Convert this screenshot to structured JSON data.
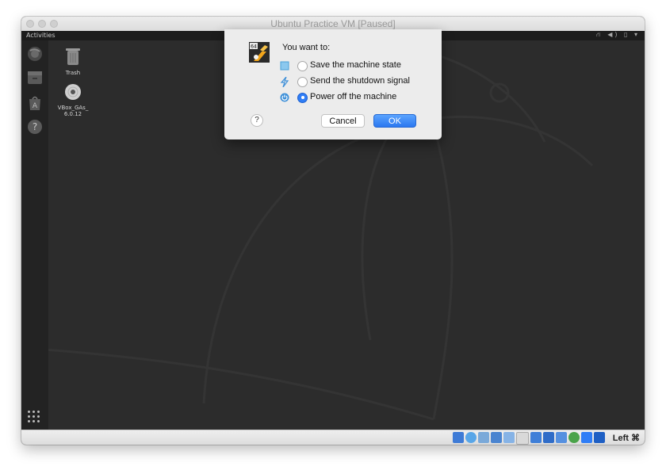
{
  "window": {
    "title": "Ubuntu Practice VM [Paused]"
  },
  "guest": {
    "topbar": {
      "activities": "Activities",
      "tray": "⛙ ◀) ▯ ▾"
    },
    "desktop_icons": [
      {
        "label": "Trash",
        "icon": "trash-icon"
      },
      {
        "label": "VBox_GAs_\n6.0.12",
        "icon": "disc-icon"
      }
    ],
    "dock": [
      "firefox-icon",
      "files-icon",
      "software-icon",
      "help-icon"
    ]
  },
  "dialog": {
    "logo_badge": "64",
    "prompt": "You want to:",
    "options": [
      {
        "label": "Save the machine state",
        "icon": "save-state-icon",
        "checked": false
      },
      {
        "label": "Send the shutdown signal",
        "icon": "shutdown-signal-icon",
        "checked": false
      },
      {
        "label": "Power off the machine",
        "icon": "power-icon",
        "checked": true
      }
    ],
    "help_label": "?",
    "cancel_label": "Cancel",
    "ok_label": "OK"
  },
  "statusbar": {
    "host_key": "Left ⌘",
    "icons": [
      "storage-icon",
      "optical-icon",
      "audio-icon",
      "network-icon",
      "usb-icon",
      "shared-folders-icon",
      "display-icon",
      "video-capture-icon",
      "recording-icon",
      "cpu-icon",
      "mouse-integration-icon",
      "keyboard-icon"
    ]
  },
  "colors": {
    "accent": "#2f7df6",
    "desktop": "#2c2c2c"
  }
}
